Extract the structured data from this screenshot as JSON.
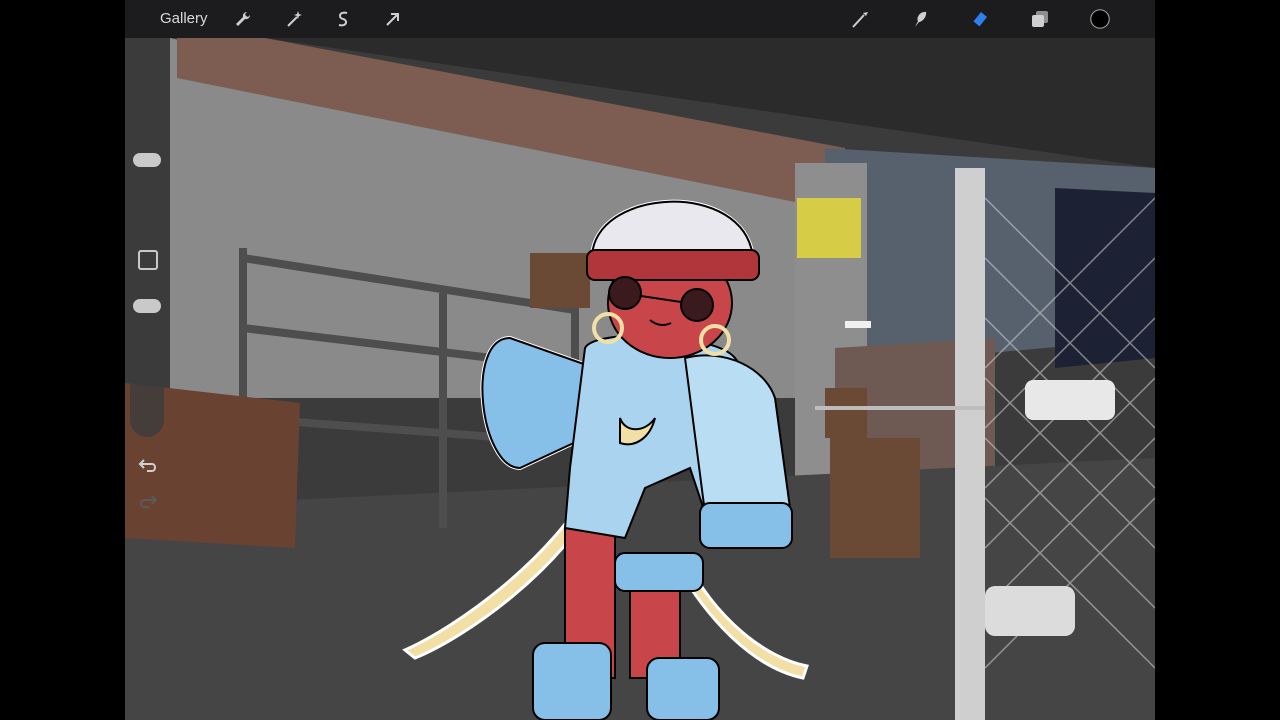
{
  "toolbar": {
    "gallery_label": "Gallery",
    "left_tools": [
      {
        "icon": "wrench-icon",
        "name": "actions"
      },
      {
        "icon": "magic-wand-icon",
        "name": "adjustments"
      },
      {
        "icon": "selection-s-icon",
        "name": "selection"
      },
      {
        "icon": "arrow-cursor-icon",
        "name": "transform"
      }
    ],
    "right_tools": [
      {
        "icon": "brush-icon",
        "name": "paint"
      },
      {
        "icon": "smudge-icon",
        "name": "smudge"
      },
      {
        "icon": "eraser-icon",
        "name": "erase",
        "active": true
      },
      {
        "icon": "layers-icon",
        "name": "layers"
      }
    ],
    "active_color": "#000000",
    "accent_color": "#2f7ff0"
  },
  "sidebar": {
    "brush_size_level": 0.45,
    "opacity_level": 0.95,
    "icons": [
      "modify-square-icon",
      "undo-icon",
      "redo-icon"
    ]
  },
  "canvas": {
    "description_colors": {
      "hoodie": "#a9d3ee",
      "skin": "#c8464a",
      "hat": "#e8e8ee",
      "hat_band": "#b0363c"
    }
  }
}
